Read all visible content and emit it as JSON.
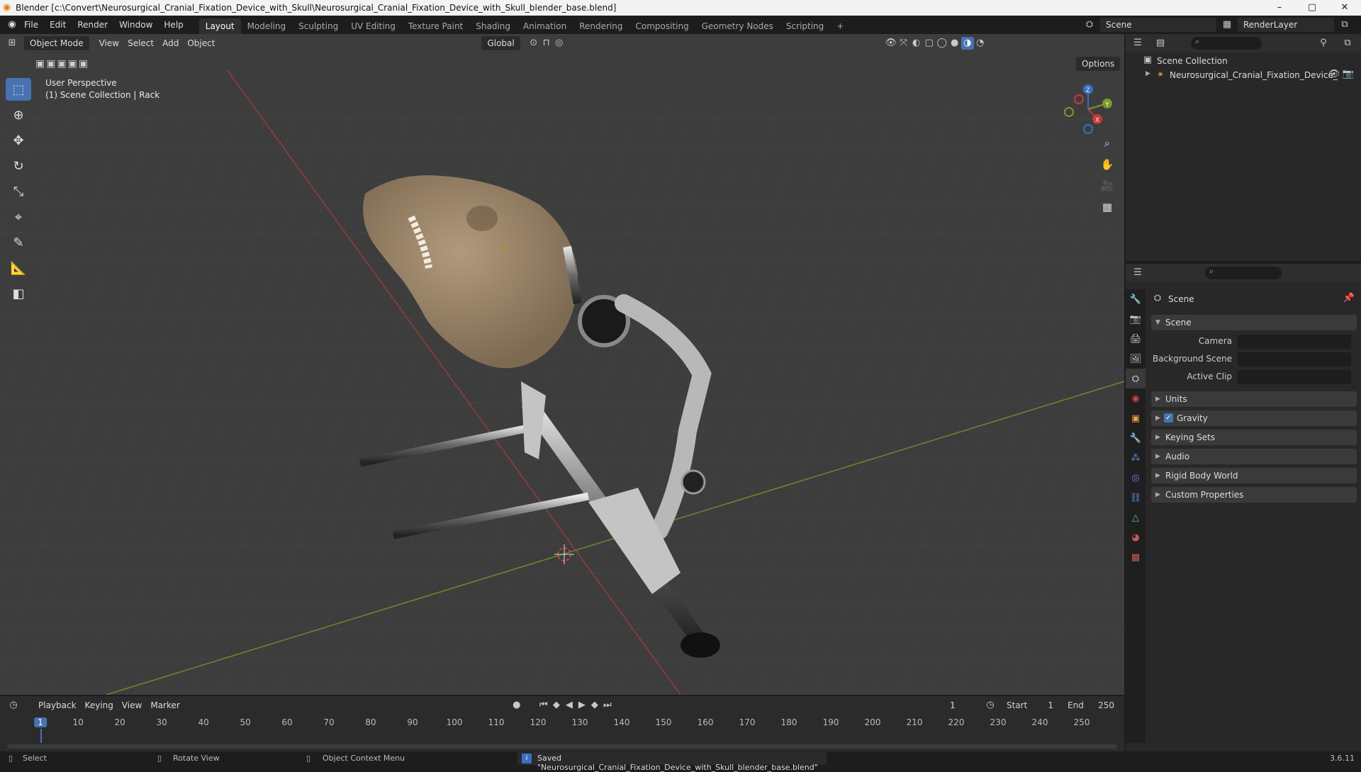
{
  "window": {
    "title": "Blender [c:\\Convert\\Neurosurgical_Cranial_Fixation_Device_with_Skull\\Neurosurgical_Cranial_Fixation_Device_with_Skull_blender_base.blend]",
    "minimize": "–",
    "maximize": "▢",
    "close": "✕"
  },
  "menu": {
    "items": [
      "File",
      "Edit",
      "Render",
      "Window",
      "Help"
    ],
    "workspaces": [
      "Layout",
      "Modeling",
      "Sculpting",
      "UV Editing",
      "Texture Paint",
      "Shading",
      "Animation",
      "Rendering",
      "Compositing",
      "Geometry Nodes",
      "Scripting"
    ],
    "active_workspace": "Layout",
    "add_tab": "+",
    "scene_name": "Scene",
    "render_layer": "RenderLayer"
  },
  "viewport": {
    "mode": "Object Mode",
    "menus": [
      "View",
      "Select",
      "Add",
      "Object"
    ],
    "transform_orientation": "Global",
    "options": "Options",
    "perspective_label": "User Perspective",
    "collection_label": "(1) Scene Collection | Rack",
    "gizmo_axes": {
      "z": "Z",
      "y": "Y",
      "x": "X"
    }
  },
  "outliner": {
    "root": "Scene Collection",
    "object": "Neurosurgical_Cranial_Fixation_Device_"
  },
  "properties": {
    "header": "Scene",
    "panel_title": "Scene",
    "fields": [
      {
        "label": "Camera"
      },
      {
        "label": "Background Scene"
      },
      {
        "label": "Active Clip"
      }
    ],
    "sections": [
      "Units",
      "Gravity",
      "Keying Sets",
      "Audio",
      "Rigid Body World",
      "Custom Properties"
    ],
    "gravity_checked": true
  },
  "timeline": {
    "menus": [
      "Playback",
      "Keying",
      "View",
      "Marker"
    ],
    "current_frame": "1",
    "start_label": "Start",
    "start": "1",
    "end_label": "End",
    "end": "250",
    "ticks": [
      "1",
      "10",
      "20",
      "30",
      "40",
      "50",
      "60",
      "70",
      "80",
      "90",
      "100",
      "110",
      "120",
      "130",
      "140",
      "150",
      "160",
      "170",
      "180",
      "190",
      "200",
      "210",
      "220",
      "230",
      "240",
      "250"
    ]
  },
  "statusbar": {
    "select": "Select",
    "rotate": "Rotate View",
    "context": "Object Context Menu",
    "message": "Saved \"Neurosurgical_Cranial_Fixation_Device_with_Skull_blender_base.blend\"",
    "version": "3.6.11"
  },
  "colors": {
    "accent": "#4772b3",
    "x_axis": "#c43a3a",
    "y_axis": "#7a9a2b",
    "z_axis": "#3a6fc4"
  }
}
